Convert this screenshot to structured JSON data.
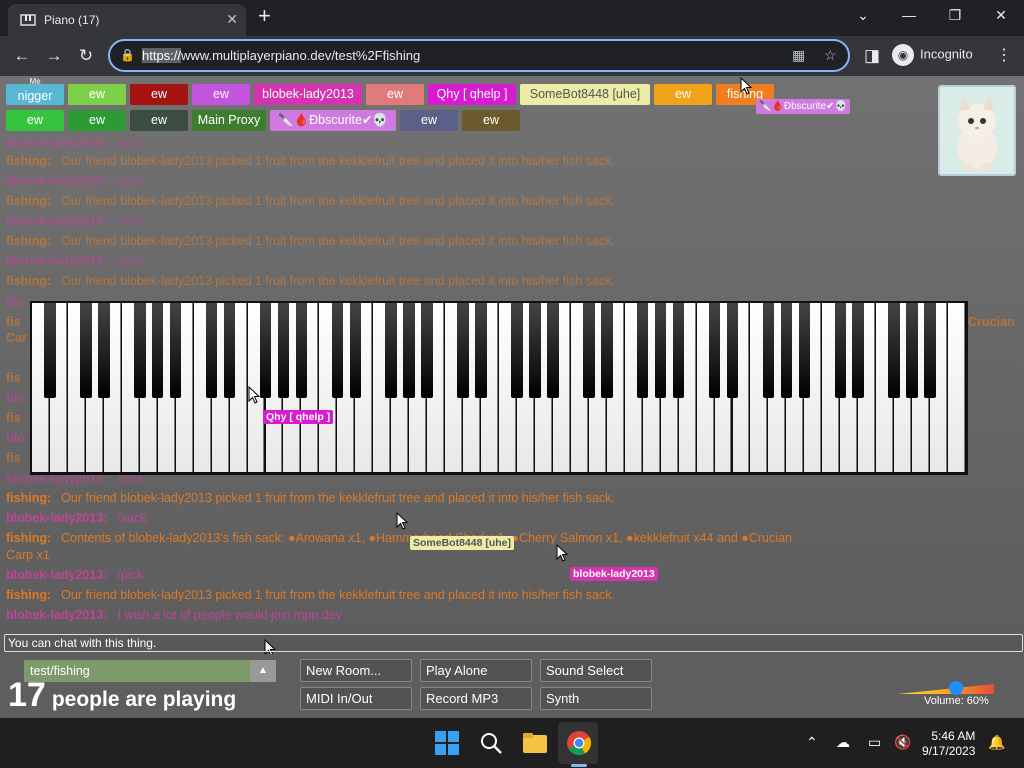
{
  "browser": {
    "tab_title": "Piano (17)",
    "url_scheme": "https://",
    "url_rest": "www.multiplayerpiano.dev/test%2Ffishing",
    "profile_label": "Incognito"
  },
  "players_top": [
    {
      "name": "nigger",
      "tag": "Me",
      "color": "#58b8d4"
    },
    {
      "name": "ew",
      "color": "#7ecf4a"
    },
    {
      "name": "ew",
      "color": "#a41212"
    },
    {
      "name": "ew",
      "color": "#c354e0"
    },
    {
      "name": "blobek-lady2013",
      "color": "#d633b0"
    },
    {
      "name": "ew",
      "color": "#e07b7b"
    },
    {
      "name": "Qhy [ qhelp ]",
      "color": "#d81ad1"
    },
    {
      "name": "SomeBot8448 [uhe]",
      "color": "#ececa6"
    },
    {
      "name": "ew",
      "color": "#f0a319"
    },
    {
      "name": "fishing",
      "color": "#f07d1e"
    }
  ],
  "players_second": [
    {
      "name": "ew",
      "color": "#35c43d"
    },
    {
      "name": "ew",
      "color": "#2e9a36"
    },
    {
      "name": "ew",
      "color": "#3b4d3f"
    },
    {
      "name": "Main Proxy",
      "color": "#3e7d2f"
    },
    {
      "name": "🔪🩸Ðbscurite✔💀",
      "color": "#cf7ae0"
    },
    {
      "name": "ew",
      "color": "#5c5f88"
    },
    {
      "name": "ew",
      "color": "#6b5a2b"
    }
  ],
  "floating_badge": "🔪🩸Ðbscurite✔💀",
  "chat": [
    {
      "who": "blobek-lady2013:",
      "msg": "/pick",
      "who_color": "#d13fa4",
      "msg_color": "#d13fa4"
    },
    {
      "who": "fishing:",
      "msg": "Our friend blobek-lady2013 picked 1 fruit from the kekklefruit tree and placed it into his/her fish sack.",
      "who_color": "#f07d1e",
      "msg_color": "#f07d1e"
    },
    {
      "who": "blobek-lady2013:",
      "msg": "/pick",
      "who_color": "#d13fa4",
      "msg_color": "#d13fa4"
    },
    {
      "who": "fishing:",
      "msg": "Our friend blobek-lady2013 picked 1 fruit from the kekklefruit tree and placed it into his/her fish sack.",
      "who_color": "#f07d1e",
      "msg_color": "#f07d1e"
    },
    {
      "who": "blobek-lady2013:",
      "msg": "/pick",
      "who_color": "#d13fa4",
      "msg_color": "#d13fa4"
    },
    {
      "who": "fishing:",
      "msg": "Our friend blobek-lady2013 picked 1 fruit from the kekklefruit tree and placed it into his/her fish sack.",
      "who_color": "#f07d1e",
      "msg_color": "#f07d1e"
    },
    {
      "who": "blobek-lady2013:",
      "msg": "/pick",
      "who_color": "#d13fa4",
      "msg_color": "#d13fa4"
    },
    {
      "who": "fishing:",
      "msg": "Our friend blobek-lady2013 picked 1 fruit from the kekklefruit tree and placed it into his/her fish sack.",
      "who_color": "#f07d1e",
      "msg_color": "#f07d1e"
    }
  ],
  "chat_bottom": [
    {
      "who": "blobek-lady2013:",
      "msg": "/pick",
      "who_color": "#d13fa4",
      "msg_color": "#d13fa4"
    },
    {
      "who": "fishing:",
      "msg": "Our friend blobek-lady2013 picked 1 fruit from the kekklefruit tree and placed it into his/her fish sack.",
      "who_color": "#f07d1e",
      "msg_color": "#f07d1e"
    },
    {
      "who": "blobek-lady2013:",
      "msg": "/sack",
      "who_color": "#d13fa4",
      "msg_color": "#d13fa4"
    },
    {
      "who": "fishing:",
      "msg": "Contents of blobek-lady2013's fish sack: ●Arowana x1, ●Hammerhead Shark x1, ●Cherry Salmon x1, ●kekklefruit x44 and ●Crucian",
      "who_color": "#f07d1e",
      "msg_color": "#f07d1e"
    },
    {
      "who": "",
      "msg": "Carp x1",
      "who_color": "#f07d1e",
      "msg_color": "#f07d1e"
    },
    {
      "who": "blobek-lady2013:",
      "msg": "/pick",
      "who_color": "#d13fa4",
      "msg_color": "#d13fa4"
    },
    {
      "who": "fishing:",
      "msg": "Our friend blobek-lady2013 picked 1 fruit from the kekklefruit tree and placed it into his/her fish sack.",
      "who_color": "#f07d1e",
      "msg_color": "#f07d1e"
    },
    {
      "who": "blobek-lady2013:",
      "msg": "I wish a lot of people would join mpp.dev",
      "who_color": "#d13fa4",
      "msg_color": "#d13fa4"
    }
  ],
  "side_fragments": [
    "blo",
    "fis",
    "Car",
    "fis",
    "blo",
    "fis",
    "blo",
    "fis"
  ],
  "crucian_fragment": "Crucian",
  "cursor_labels": [
    {
      "name": "Qhy [ qhelp ]",
      "color": "#d81ad1"
    },
    {
      "name": "SomeBot8448 [uhe]",
      "color": "#ececa6",
      "text_color": "#555"
    },
    {
      "name": "blobek-lady2013",
      "color": "#d633b0"
    }
  ],
  "chat_placeholder": "You can chat with this thing.",
  "room": {
    "name": "test/fishing"
  },
  "player_count": "17",
  "player_count_label": "people are playing",
  "buttons": {
    "new_room": "New Room...",
    "play_alone": "Play Alone",
    "sound_select": "Sound Select",
    "midi": "MIDI In/Out",
    "record": "Record MP3",
    "synth": "Synth"
  },
  "volume": {
    "label": "Volume: 60%",
    "level": 0.6
  },
  "taskbar": {
    "time": "5:46 AM",
    "date": "9/17/2023"
  }
}
